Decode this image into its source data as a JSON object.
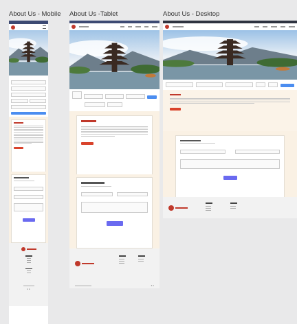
{
  "frames": {
    "mobile": {
      "title": "About Us  - Mobile"
    },
    "tablet": {
      "title": "About Us -Tablet"
    },
    "desktop": {
      "title": "About Us - Desktop"
    }
  },
  "colors": {
    "canvas": "#e9e9ea",
    "topbar": "#3d4a73",
    "brand": "#c0392b",
    "accent_blue": "#4b8df0",
    "button_purple": "#6a6af0",
    "section_bg": "#faf1e4"
  },
  "icons": [
    "logo-icon",
    "calendar-icon",
    "chevron-down-icon",
    "social-icon"
  ]
}
